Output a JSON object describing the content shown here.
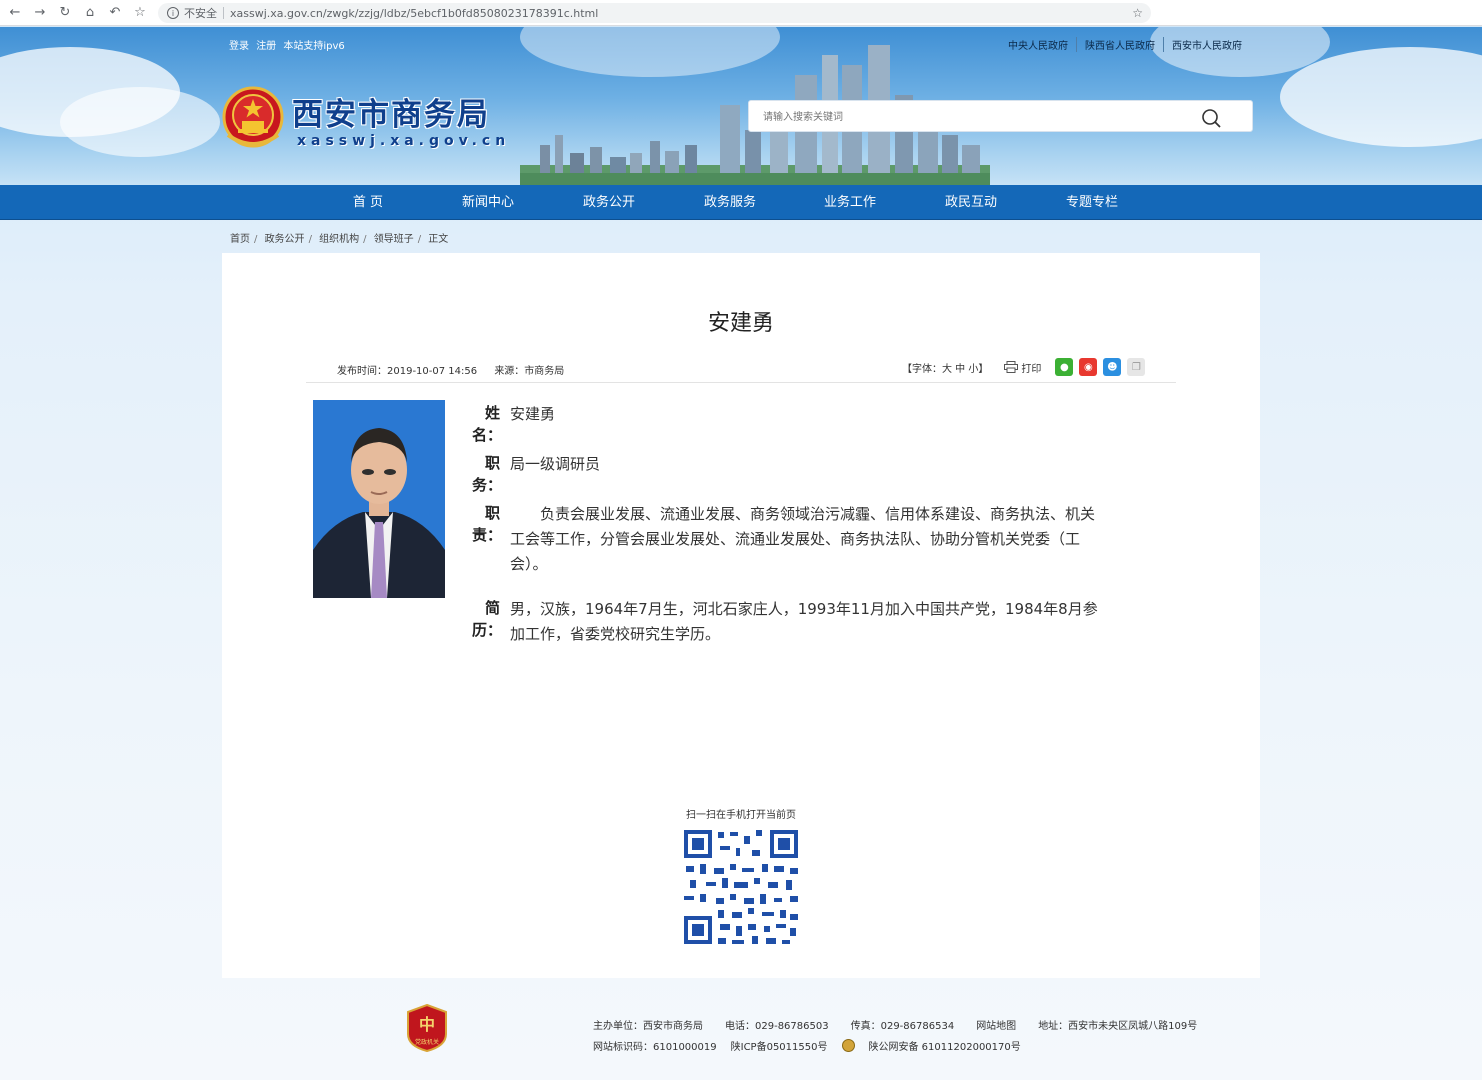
{
  "browser": {
    "security_label": "不安全",
    "url": "xasswj.xa.gov.cn/zwgk/zzjg/ldbz/5ebcf1b0fd8508023178391c.html"
  },
  "header": {
    "top_left_links": [
      "登录",
      "注册",
      "本站支持ipv6"
    ],
    "top_right_links": [
      "中央人民政府",
      "陕西省人民政府",
      "西安市人民政府"
    ],
    "site_title": "西安市商务局",
    "site_domain": "xasswj.xa.gov.cn",
    "search_placeholder": "请输入搜索关键词"
  },
  "nav": [
    "首  页",
    "新闻中心",
    "政务公开",
    "政务服务",
    "业务工作",
    "政民互动",
    "专题专栏"
  ],
  "breadcrumb": [
    "首页",
    "政务公开",
    "组织机构",
    "领导班子",
    "正文"
  ],
  "article": {
    "title": "安建勇",
    "publish_time_label": "发布时间：2019-10-07 14:56",
    "source_label": "来源：市商务局",
    "font_size_ctrl": "【字体：大 中 小】",
    "print_label": "打印",
    "profile": {
      "name_label": "姓名：",
      "name": "安建勇",
      "position_label": "职务：",
      "position": "局一级调研员",
      "duty_label": "职责：",
      "duty": "　　负责会展业发展、流通业发展、商务领域治污减霾、信用体系建设、商务执法、机关工会等工作，分管会展业发展处、流通业发展处、商务执法队、协助分管机关党委（工会）。",
      "bio_label": "简历：",
      "bio": "男，汉族，1964年7月生，河北石家庄人，1993年11月加入中国共产党，1984年8月参加工作，省委党校研究生学历。"
    },
    "qr_caption": "扫一扫在手机打开当前页"
  },
  "footer": {
    "sponsor": "主办单位：西安市商务局",
    "phone": "电话：029-86786503",
    "fax": "传真：029-86786534",
    "sitemap": "网站地图",
    "address": "地址：西安市未央区凤城八路109号",
    "site_id": "网站标识码：6101000019",
    "icp": "陕ICP备05011550号",
    "police": "陕公网安备 61011202000170号",
    "badge_text": "党政机关"
  },
  "colors": {
    "nav_bg": "#1468b8",
    "title_blue": "#0f3f8c"
  }
}
